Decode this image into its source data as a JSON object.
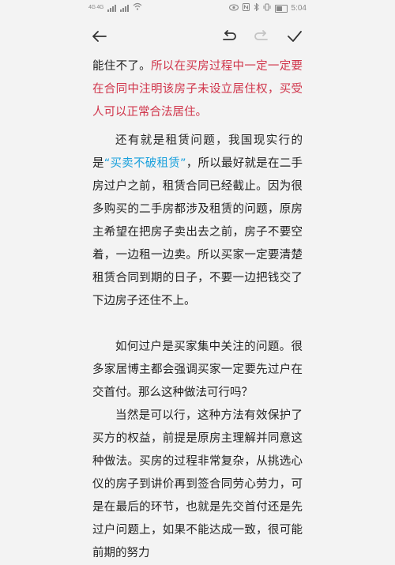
{
  "status_bar": {
    "left_indicators": "4G 4G",
    "time": "5:04",
    "icons": [
      "signal-icon",
      "wifi-icon",
      "eye-icon",
      "nfc-icon",
      "bluetooth-icon",
      "vibrate-icon",
      "battery-icon"
    ]
  },
  "toolbar": {
    "icons": [
      "back-arrow-icon",
      "undo-icon",
      "redo-icon",
      "check-icon"
    ]
  },
  "colors": {
    "highlight_red": "#d0344a",
    "highlight_blue": "#1aa0dc",
    "text": "#222222",
    "background": "#f3f3f3"
  },
  "article": {
    "p1_plain": "能住不了。",
    "p1_red": "所以在买房过程中一定一定要在合同中注明该房子未设立居住权，买受人可以正常合法居住。",
    "p2_pre": "还有就是租赁问题，我国现实行的是",
    "p2_blue": "“买卖不破租赁”",
    "p2_post": "，所以最好就是在二手房过户之前，租赁合同已经截止。因为很多购买的二手房都涉及租赁的问题，原房主希望在把房子卖出去之前，房子不要空着，一边租一边卖。所以买家一定要清楚租赁合同到期的日子，不要一边把钱交了下边房子还住不上。",
    "p3": "如何过户是买家集中关注的问题。很多家居博主都会强调买家一定要先过户在交首付。那么这种做法可行吗？",
    "p4": "当然是可以行，这种方法有效保护了买方的权益，前提是原房主理解并同意这种做法。买房的过程非常复杂，从挑选心仪的房子到讲价再到签合同劳心劳力，可是在最后的环节，也就是先交首付还是先过户问题上，如果不能达成一致，很可能前期的努力"
  }
}
